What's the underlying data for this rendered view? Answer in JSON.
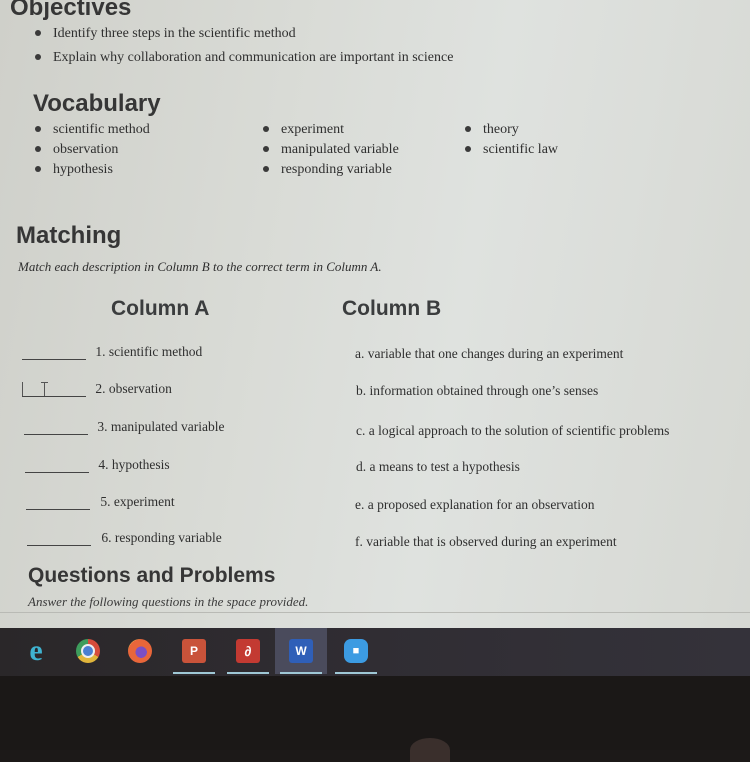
{
  "objectives": {
    "title": "Objectives",
    "items": [
      "Identify three steps in the scientific method",
      "Explain why collaboration and communication are important in science"
    ]
  },
  "vocabulary": {
    "title": "Vocabulary",
    "columns": [
      [
        "scientific method",
        "observation",
        "hypothesis"
      ],
      [
        "experiment",
        "manipulated variable",
        "responding variable"
      ],
      [
        "theory",
        "scientific law"
      ]
    ]
  },
  "matching": {
    "title": "Matching",
    "instructions": "Match each description in Column B to the correct term in Column A.",
    "column_a_header": "Column A",
    "column_b_header": "Column B",
    "column_a": [
      {
        "answer": "",
        "label": "1. scientific method"
      },
      {
        "answer": "",
        "label": "2. observation"
      },
      {
        "answer": "",
        "label": "3. manipulated variable"
      },
      {
        "answer": "",
        "label": "4. hypothesis"
      },
      {
        "answer": "",
        "label": "5. experiment"
      },
      {
        "answer": "",
        "label": "6. responding variable"
      }
    ],
    "column_b": [
      "a. variable that one changes during an experiment",
      "b. information obtained through one’s senses",
      "c. a logical approach to the solution of scientific problems",
      "d. a means to test a hypothesis",
      "e. a proposed explanation for an observation",
      "f. variable that is observed during an experiment"
    ]
  },
  "questions": {
    "title": "Questions and Problems",
    "instructions": "Answer the following questions in the space provided."
  },
  "taskbar": {
    "apps": [
      {
        "name": "Internet Explorer",
        "icon": "ie-icon",
        "glyph": "e",
        "color": "#3fa9c9",
        "running": false,
        "active": false
      },
      {
        "name": "Google Chrome",
        "icon": "chrome-icon",
        "glyph": "",
        "color": "#d9a43a",
        "running": false,
        "active": false
      },
      {
        "name": "Firefox",
        "icon": "firefox-icon",
        "glyph": "",
        "color": "#e0663a",
        "running": false,
        "active": false
      },
      {
        "name": "PowerPoint",
        "icon": "powerpoint-icon",
        "glyph": "P",
        "color": "#c9533a",
        "running": true,
        "active": false
      },
      {
        "name": "Adobe Acrobat",
        "icon": "acrobat-icon",
        "glyph": "∂",
        "color": "#c33a32",
        "running": true,
        "active": false
      },
      {
        "name": "Word",
        "icon": "word-icon",
        "glyph": "W",
        "color": "#2f5fb8",
        "running": true,
        "active": true
      },
      {
        "name": "Zoom",
        "icon": "zoom-icon",
        "glyph": "■",
        "color": "#3c9be2",
        "running": true,
        "active": false
      }
    ]
  }
}
